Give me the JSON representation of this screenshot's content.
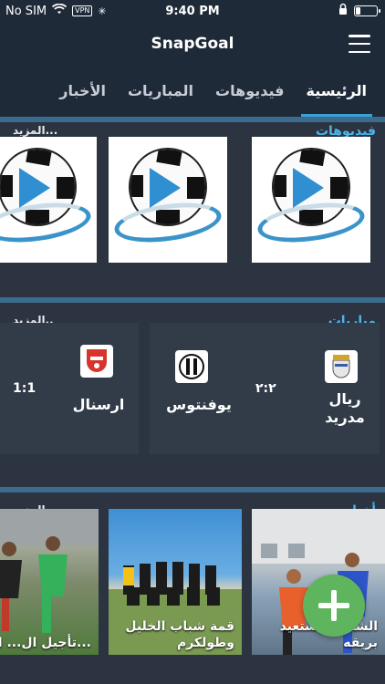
{
  "status_bar": {
    "carrier": "No SIM",
    "vpn": "VPN",
    "time": "9:40 PM",
    "battery_level": 0.2
  },
  "header": {
    "title": "SnapGoal",
    "menu_icon": "hamburger-menu-icon"
  },
  "tabs": [
    {
      "label": "الرئيسية",
      "active": true
    },
    {
      "label": "فيديوهات",
      "active": false
    },
    {
      "label": "المباريات",
      "active": false
    },
    {
      "label": "الأخبار",
      "active": false
    }
  ],
  "videos": {
    "title": "فيديوهات",
    "more": "المزيد..."
  },
  "matches": {
    "title": "مباريات",
    "more": "المزيد..",
    "items": [
      {
        "home": "ريال مدريد",
        "away": "يوفنتوس",
        "score": "٢:٢"
      },
      {
        "home": "ارسنال",
        "away": "",
        "score": "1:1"
      }
    ]
  },
  "news": {
    "title": "أخبار",
    "more": "المزيد..",
    "items": [
      {
        "caption": "الشاطئ يستعيد بريقه"
      },
      {
        "caption": "قمة شباب الخليل وطولكرم"
      },
      {
        "caption": "تأجيل ال... الس..."
      }
    ]
  },
  "colors": {
    "accent": "#3aa1d6",
    "fab": "#5fb55d",
    "bg": "#2b3440",
    "bar": "#1f2a38"
  }
}
